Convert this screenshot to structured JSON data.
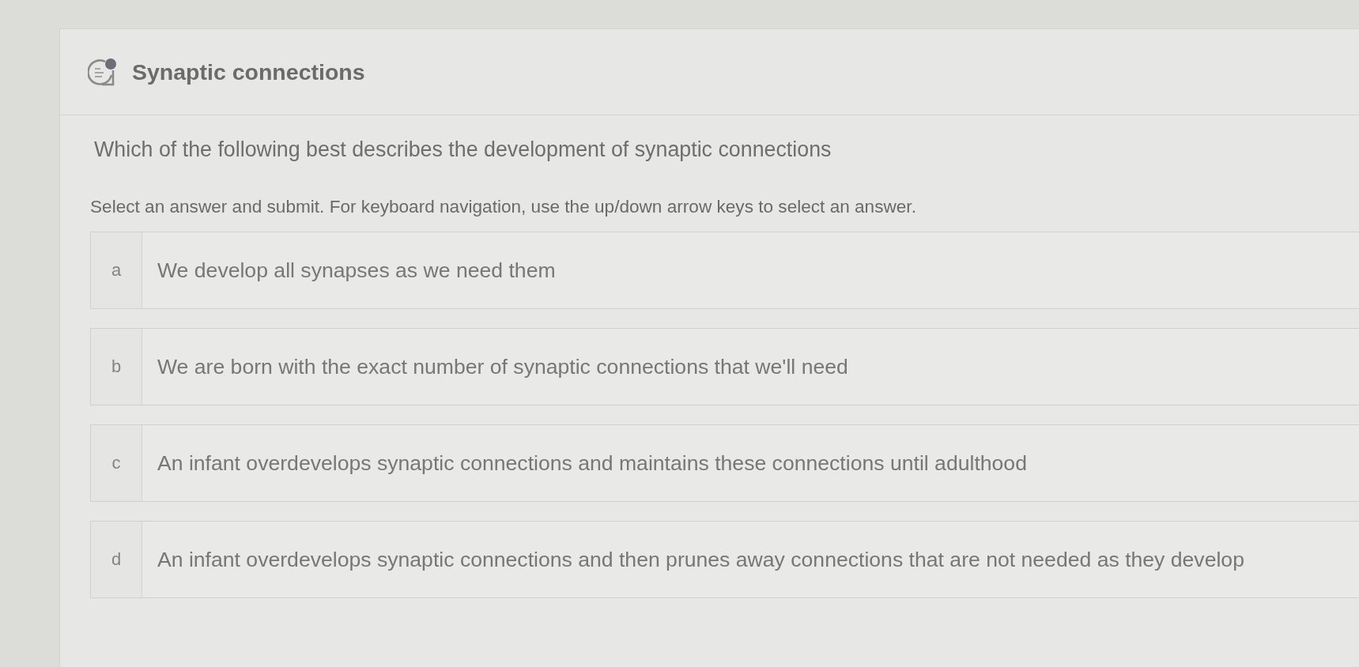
{
  "header": {
    "title": "Synaptic connections"
  },
  "question": {
    "prompt": "Which of the following best describes the development of synaptic connections",
    "instructions": "Select an answer and submit. For keyboard navigation, use the up/down arrow keys to select an answer."
  },
  "options": [
    {
      "letter": "a",
      "text": "We develop all synapses as we need them",
      "selected": false
    },
    {
      "letter": "b",
      "text": "We are born with the exact number of synaptic connections that we'll need",
      "selected": false
    },
    {
      "letter": "c",
      "text": "An infant overdevelops synaptic connections and maintains these connections until adulthood",
      "selected": false
    },
    {
      "letter": "d",
      "text": "An infant overdevelops synaptic connections and then prunes away connections that are not needed as they develop",
      "selected": false
    }
  ]
}
